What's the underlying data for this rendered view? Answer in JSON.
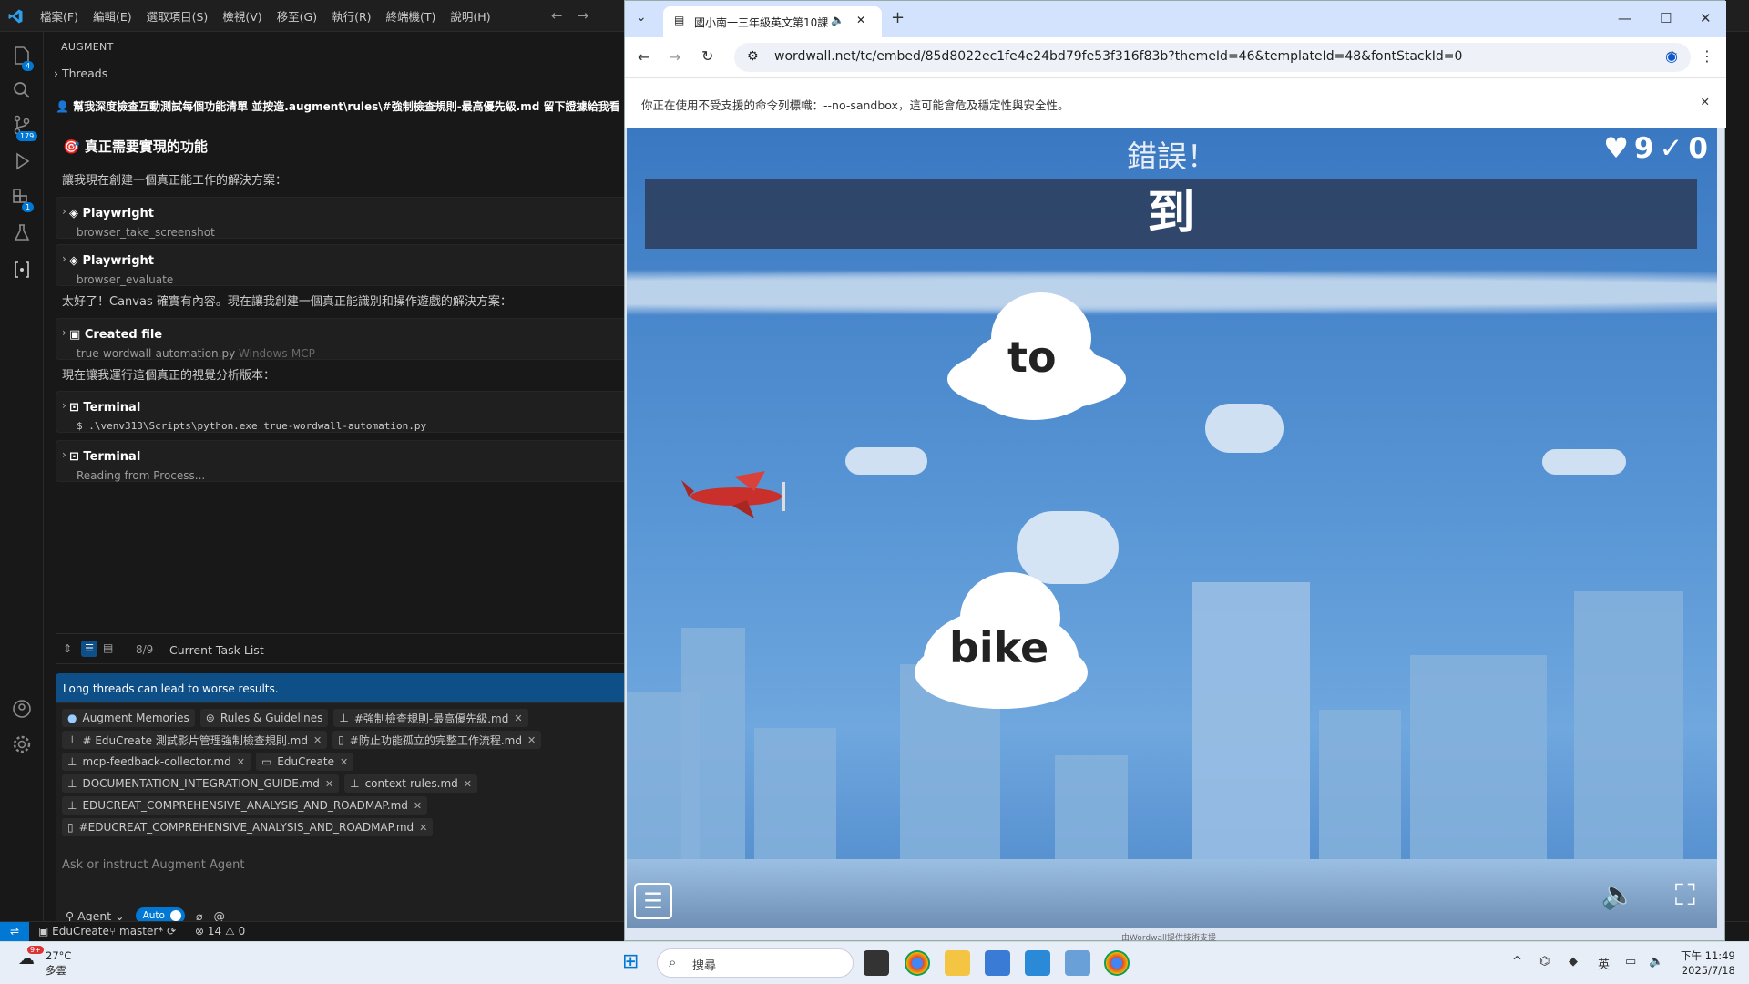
{
  "vscode": {
    "menu": [
      "檔案(F)",
      "編輯(E)",
      "選取項目(S)",
      "檢視(V)",
      "移至(G)",
      "執行(R)",
      "終端機(T)",
      "說明(H)"
    ],
    "badges": {
      "explorer": "4",
      "source_control": "179",
      "extensions": "1"
    },
    "panel_header": "AUGMENT",
    "threads_label": "Threads",
    "user_message": "幫我深度檢查互動測試每個功能清單 並按造.augment\\rules\\#強制檢查規則-最高優先級.md 留下證據給我看 ###",
    "heading": "🎯 真正需要實現的功能",
    "para1": "讓我現在創建一個真正能工作的解決方案：",
    "tool1": {
      "title": "Playwright",
      "sub": "browser_take_screenshot"
    },
    "tool2": {
      "title": "Playwright",
      "sub": "browser_evaluate"
    },
    "para2": "太好了！Canvas 確實有內容。現在讓我創建一個真正能識別和操作遊戲的解決方案：",
    "tool3": {
      "title": "Created file",
      "sub": "true-wordwall-automation.py",
      "sub2": "Windows-MCP"
    },
    "para3": "現在讓我運行這個真正的視覺分析版本：",
    "tool4": {
      "title": "Terminal",
      "sub": "$ .\\venv313\\Scripts\\python.exe true-wordwall-automation.py"
    },
    "tool5": {
      "title": "Terminal",
      "sub": "Reading from Process..."
    },
    "task_count": "8/9",
    "task_label": "Current Task List",
    "warning": "Long threads can lead to worse results.",
    "chips": [
      "Augment Memories",
      "Rules & Guidelines",
      "#強制檢查規則-最高優先級.md",
      "# EduCreate 測試影片管理強制檢查規則.md",
      "#防止功能孤立的完整工作流程.md",
      "mcp-feedback-collector.md",
      "EduCreate",
      "DOCUMENTATION_INTEGRATION_GUIDE.md",
      "context-rules.md",
      "EDUCREAT_COMPREHENSIVE_ANALYSIS_AND_ROADMAP.md",
      "#EDUCREAT_COMPREHENSIVE_ANALYSIS_AND_ROADMAP.md"
    ],
    "input_placeholder": "Ask or instruct Augment Agent",
    "agent_label": "Agent",
    "auto_label": "Auto",
    "status": {
      "workspace": "EduCreate",
      "branch": "master*",
      "errors": "14",
      "warnings": "0"
    }
  },
  "chrome": {
    "tab_title": "國小南一三年級英文第10課",
    "url": "wordwall.net/tc/embed/85d8022ec1fe4e24bd79fe53f316f83b?themeId=46&templateId=48&fontStackId=0",
    "infobar": "你正在使用不受支援的命令列標幟：--no-sandbox，這可能會危及穩定性與安全性。"
  },
  "game": {
    "status_text": "錯誤！",
    "lives": "9",
    "score": "0",
    "question": "到",
    "answers": [
      "to",
      "bike"
    ],
    "credit": "由Wordwall提供技術支援"
  },
  "taskbar": {
    "weather_badge": "9+",
    "temperature": "27°C",
    "weather_desc": "多雲",
    "search_placeholder": "搜尋",
    "ime": "英",
    "time": "下午 11:49",
    "date": "2025/7/18"
  }
}
